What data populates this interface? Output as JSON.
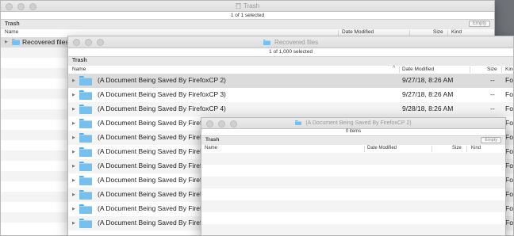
{
  "trash_window": {
    "title": "Trash",
    "status": "1 of 1 selected",
    "toolbar_label": "Trash",
    "empty_label": "Empty",
    "columns": {
      "name": "Name",
      "date": "Date Modified",
      "size": "Size",
      "kind": "Kind"
    },
    "rows": [
      {
        "name": "Recovered files"
      }
    ]
  },
  "recovered_window": {
    "title": "Recovered files",
    "status": "1 of 1,000 selected",
    "toolbar_label": "Trash",
    "columns": {
      "name": "Name",
      "date": "Date Modified",
      "size": "Size",
      "kind": "Kind"
    },
    "rows": [
      {
        "name": "(A Document Being Saved By FirefoxCP 2)",
        "date": "9/27/18, 8:26 AM",
        "size": "--",
        "kind": "Fol"
      },
      {
        "name": "(A Document Being Saved By FirefoxCP 3)",
        "date": "9/27/18, 8:26 AM",
        "size": "--",
        "kind": "Fol"
      },
      {
        "name": "(A Document Being Saved By FirefoxCP 4)",
        "date": "9/28/18, 8:26 AM",
        "size": "--",
        "kind": "Fol"
      },
      {
        "name": "(A Document Being Saved By Firefo",
        "date": "",
        "size": "--",
        "kind": "Fol"
      },
      {
        "name": "(A Document Being Saved By Firefo",
        "date": "",
        "size": "--",
        "kind": "Fol"
      },
      {
        "name": "(A Document Being Saved By Firefo",
        "date": "",
        "size": "--",
        "kind": "Fol"
      },
      {
        "name": "(A Document Being Saved By Firefo",
        "date": "",
        "size": "--",
        "kind": "Fol"
      },
      {
        "name": "(A Document Being Saved By Firefo",
        "date": "",
        "size": "--",
        "kind": "Fol"
      },
      {
        "name": "(A Document Being Saved By Firefo",
        "date": "",
        "size": "--",
        "kind": "Fol"
      },
      {
        "name": "(A Document Being Saved By Firefo",
        "date": "",
        "size": "--",
        "kind": "Fol"
      },
      {
        "name": "(A Document Being Saved By Firefo",
        "date": "",
        "size": "--",
        "kind": "Fol"
      }
    ]
  },
  "doc_window": {
    "title": "(A Document Being Saved By FirefoxCP 2)",
    "status": "0 items",
    "toolbar_label": "Trash",
    "empty_label": "Empty",
    "columns": {
      "name": "Name",
      "date": "Date Modified",
      "size": "Size",
      "kind": "Kind"
    }
  },
  "colors": {
    "folder": "#76c0f0",
    "selection": "#dcdcdc",
    "desktop": "#6f7378"
  }
}
